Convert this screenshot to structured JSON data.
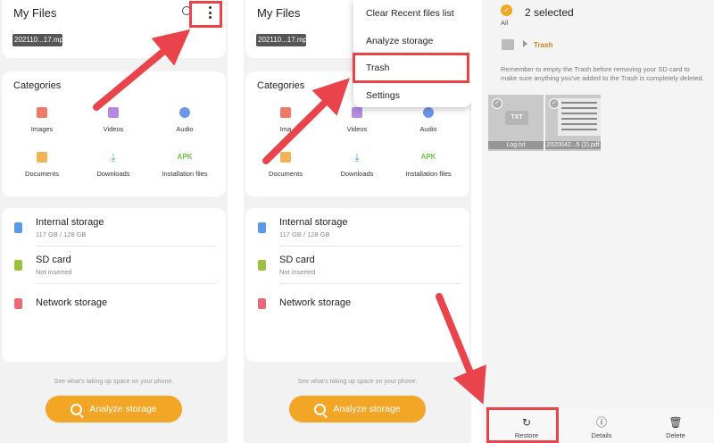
{
  "panel1": {
    "title": "My Files",
    "recent_file": "202110...17.mp4",
    "categories_title": "Categories",
    "categories": [
      "Images",
      "Videos",
      "Audio",
      "Documents",
      "Downloads",
      "Installation files"
    ],
    "apk_text": "APK",
    "storage": {
      "internal_name": "Internal storage",
      "internal_sub": "117 GB / 128 GB",
      "sd_name": "SD card",
      "sd_sub": "Not inserted",
      "network_name": "Network storage"
    },
    "hint": "See what's taking up space on your phone.",
    "analyze_label": "Analyze storage"
  },
  "panel2": {
    "title": "My Files",
    "recent_file": "202110...17.mp4",
    "categories_title": "Categories",
    "categories": [
      "Ima",
      "Videos",
      "Audio",
      "Documents",
      "Downloads",
      "Installation files"
    ],
    "apk_text": "APK",
    "storage": {
      "internal_name": "Internal storage",
      "internal_sub": "117 GB / 128 GB",
      "sd_name": "SD card",
      "sd_sub": "Not inserted",
      "network_name": "Network storage"
    },
    "hint": "See what's taking up space on your phone.",
    "analyze_label": "Analyze storage",
    "menu": [
      "Clear Recent files list",
      "Analyze storage",
      "Trash",
      "Settings"
    ]
  },
  "panel3": {
    "selected_text": "2 selected",
    "all_label": "All",
    "breadcrumb": "Trash",
    "note": "Remember to empty the Trash before removing your SD card to make sure anything you've added to the Trash is completely deleted.",
    "files": [
      {
        "name": "Log.txt",
        "badge": "TXT"
      },
      {
        "name": "2020042...5 (2).pdf"
      }
    ],
    "bottom_actions": [
      "Restore",
      "Details",
      "Delete"
    ]
  },
  "colors": {
    "accent": "#f3a626",
    "highlight": "#e9434b",
    "background": "#f2f2f2"
  },
  "icons": [
    "search-icon",
    "more-options-icon",
    "image-icon",
    "video-icon",
    "audio-icon",
    "document-icon",
    "download-icon",
    "apk-icon",
    "phone-icon",
    "sd-card-icon",
    "network-icon",
    "analyze-icon",
    "home-icon",
    "restore-icon",
    "info-icon",
    "trash-icon"
  ]
}
